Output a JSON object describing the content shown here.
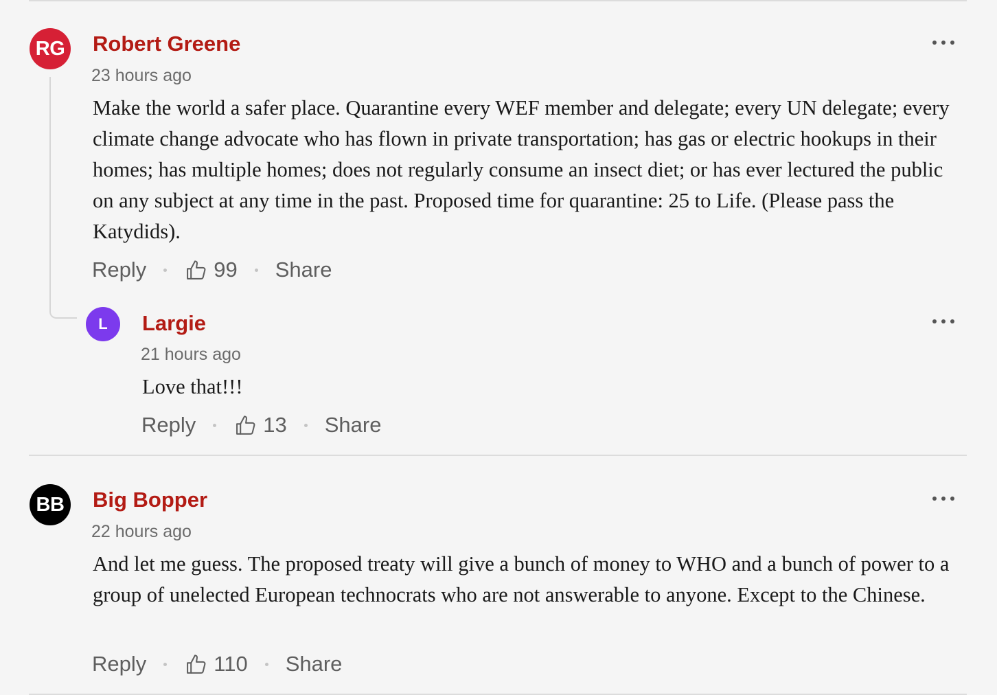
{
  "colors": {
    "author": "#b31b14",
    "avatar_rg": "#d62035",
    "avatar_l": "#7c3aed",
    "avatar_bb": "#000000"
  },
  "comments": [
    {
      "initials": "RG",
      "author": "Robert Greene",
      "time": "23 hours ago",
      "text": "Make the world a safer place. Quarantine every WEF member and delegate; every UN delegate; every climate change advocate who has flown in private transportation; has gas or electric hookups in their homes; has multiple homes; does not regularly consume an insect diet; or has ever lectured the public on any subject at any time in the past. Proposed time for quarantine: 25 to Life. (Please pass the Katydids).",
      "reply_label": "Reply",
      "likes": "99",
      "share_label": "Share",
      "replies": [
        {
          "initials": "L",
          "author": "Largie",
          "time": "21 hours ago",
          "text": "Love that!!!",
          "reply_label": "Reply",
          "likes": "13",
          "share_label": "Share"
        }
      ]
    },
    {
      "initials": "BB",
      "author": "Big Bopper",
      "time": "22 hours ago",
      "text": "And let me guess. The proposed treaty will give a bunch of money to WHO and a bunch of power to a group of unelected European technocrats who are not answerable to anyone. Except to the Chinese.",
      "reply_label": "Reply",
      "likes": "110",
      "share_label": "Share"
    }
  ],
  "icons": {
    "like": "thumbs-up-icon",
    "more": "more-options-icon"
  }
}
